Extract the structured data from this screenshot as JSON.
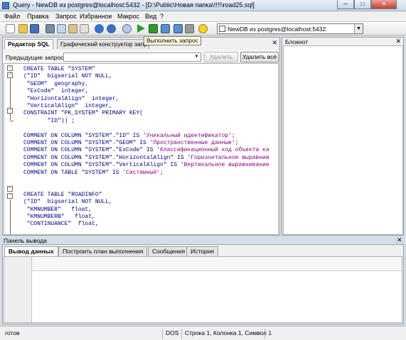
{
  "window": {
    "title": "Query - NewDB из postgres@localhost:5432 - [D:\\Public\\Новая папка\\!!!!\\road25.sql]"
  },
  "menu": [
    "Файл",
    "Правка",
    "Запрос",
    "Избранное",
    "Макрос",
    "Вид",
    "?"
  ],
  "toolbar": {
    "connection": "NewDB из postgres@localhost:5432",
    "tooltip": "Выполнить запрос"
  },
  "editor": {
    "tabs": [
      "Редактор SQL",
      "Графический конструктор запросов"
    ],
    "prev_queries_label": "Предыдущие запросы",
    "delete_button": "Удалить",
    "delete_all_button": "Удалить всё",
    "code_lines": [
      "CREATE TABLE \"SYSTEM\"",
      "(\"ID\"  bigserial NOT NULL,",
      " \"GEOM\"  geography,",
      " \"ExCode\"  integer,",
      " \"HorizontalAlign\"  integer,",
      " \"VerticalAlign\"  integer,",
      "CONSTRAINT \"PK_SYSTEM\" PRIMARY KEY(",
      "       \"ID\")) ;",
      "",
      "COMMENT ON COLUMN \"SYSTEM\".\"ID\" IS 'Уникальный идентификатор';",
      "COMMENT ON COLUMN \"SYSTEM\".\"GEOM\" IS 'Пространственные данные';",
      "COMMENT ON COLUMN \"SYSTEM\".\"ExCode\" IS 'Классификационный код объекта ка",
      "COMMENT ON COLUMN \"SYSTEM\".\"HorizontalAlign\" IS 'Горизонтальное выравнив",
      "COMMENT ON COLUMN \"SYSTEM\".\"VerticalAlign\" IS 'Вертикальное выравнивание",
      "COMMENT ON TABLE \"SYSTEM\" IS 'Системный';",
      "",
      "",
      "CREATE TABLE \"ROADINFO\"",
      "(\"ID\"  bigserial NOT NULL,",
      " \"KMNUMBER\"   float,",
      " \"KMNUMBERB\"   float,",
      " \"CONTINUANCE\"  float,"
    ]
  },
  "notepad": {
    "title": "Блокнот"
  },
  "output": {
    "title": "Панель вывода",
    "tabs": [
      "Вывод данных",
      "Построить план выполнения",
      "Сообщения",
      "История"
    ]
  },
  "status": {
    "state": "готов",
    "encoding": "DOS",
    "position": "Строка 1, Колонка 1, Символ 1"
  },
  "colors": {
    "keyword": "#000080",
    "string": "#800000",
    "comment_text": "#800080"
  }
}
